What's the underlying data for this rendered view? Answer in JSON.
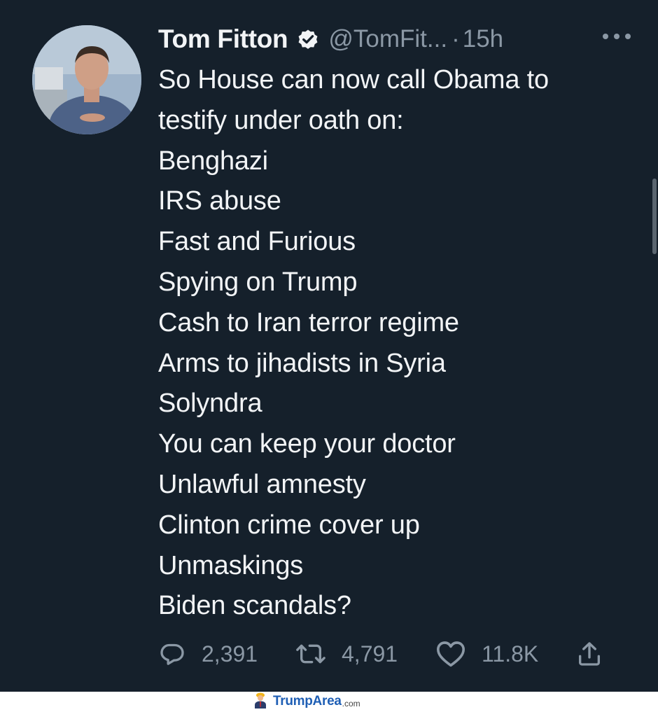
{
  "tweet": {
    "author_name": "Tom Fitton",
    "handle": "@TomFit...",
    "separator": "·",
    "time": "15h",
    "lines": [
      "So House can now call Obama to",
      "testify under oath on:",
      "Benghazi",
      "IRS abuse",
      "Fast and Furious",
      "Spying on Trump",
      "Cash to Iran terror regime",
      "Arms to jihadists in Syria",
      "Solyndra",
      "You can keep your doctor",
      "Unlawful amnesty",
      "Clinton crime cover up",
      "Unmaskings",
      "Biden scandals?"
    ],
    "replies": "2,391",
    "retweets": "4,791",
    "likes": "11.8K"
  },
  "icons": {
    "verified": "verified-badge-icon",
    "more": "more-options-icon",
    "reply": "reply-icon",
    "retweet": "retweet-icon",
    "like": "heart-icon",
    "share": "share-icon"
  },
  "watermark": {
    "brand": "TrumpArea",
    "tld": ".com"
  },
  "colors": {
    "background": "#15202b",
    "text": "#f2f4f6",
    "secondary_text": "#8b98a5",
    "watermark_brand": "#1f5fb5"
  }
}
